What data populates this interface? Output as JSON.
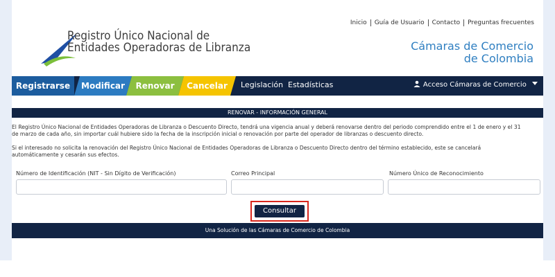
{
  "header": {
    "title_line1": "Registro Único Nacional de",
    "title_line2": "Entidades Operadoras de Libranza",
    "top_links": [
      "Inicio",
      "Guía de Usuario",
      "Contacto",
      "Preguntas frecuentes"
    ],
    "camaras_line1": "Cámaras de Comercio",
    "camaras_line2": "de Colombia"
  },
  "nav": {
    "tabs": [
      "Registrarse",
      "Modificar",
      "Renovar",
      "Cancelar"
    ],
    "links": [
      "Legislación",
      "Estadísticas"
    ],
    "acceso": "Acceso Cámaras de Comercio"
  },
  "main": {
    "section_title": "RENOVAR - INFORMACIÓN GENERAL",
    "para1_line1": "El Registro Único Nacional de Entidades Operadoras de Libranza o Descuento Directo, tendrá una vigencia anual y deberá renovarse dentro del periodo comprendido entre el 1 de enero y el 31",
    "para1_line2": "de marzo de cada año, sin importar cuál hubiere sido la fecha de la inscripción inicial o renovación por parte del operador de libranzas o descuento directo.",
    "para2_line1": "Si el interesado no solicita la renovación del Registro Único Nacional de Entidades Operadoras de Libranza o Descuento Directo dentro del término establecido, este se cancelará",
    "para2_line2": "automáticamente y cesarán sus efectos.",
    "fields": [
      {
        "label": "Número de Identificación (NIT - Sin Dígito de Verificación)",
        "value": ""
      },
      {
        "label": "Correo Principal",
        "value": ""
      },
      {
        "label": "Número Único de Reconocimiento",
        "value": ""
      }
    ],
    "button": "Consultar"
  },
  "footer": {
    "text": "Una Solución de las Cámaras de Comercio de Colombia"
  },
  "colors": {
    "navy": "#112444",
    "registrarse": "#1c5c9e",
    "modificar": "#2c7bc1",
    "renovar": "#8cbf3f",
    "cancelar": "#f5c400",
    "highlight": "#d9261c"
  }
}
